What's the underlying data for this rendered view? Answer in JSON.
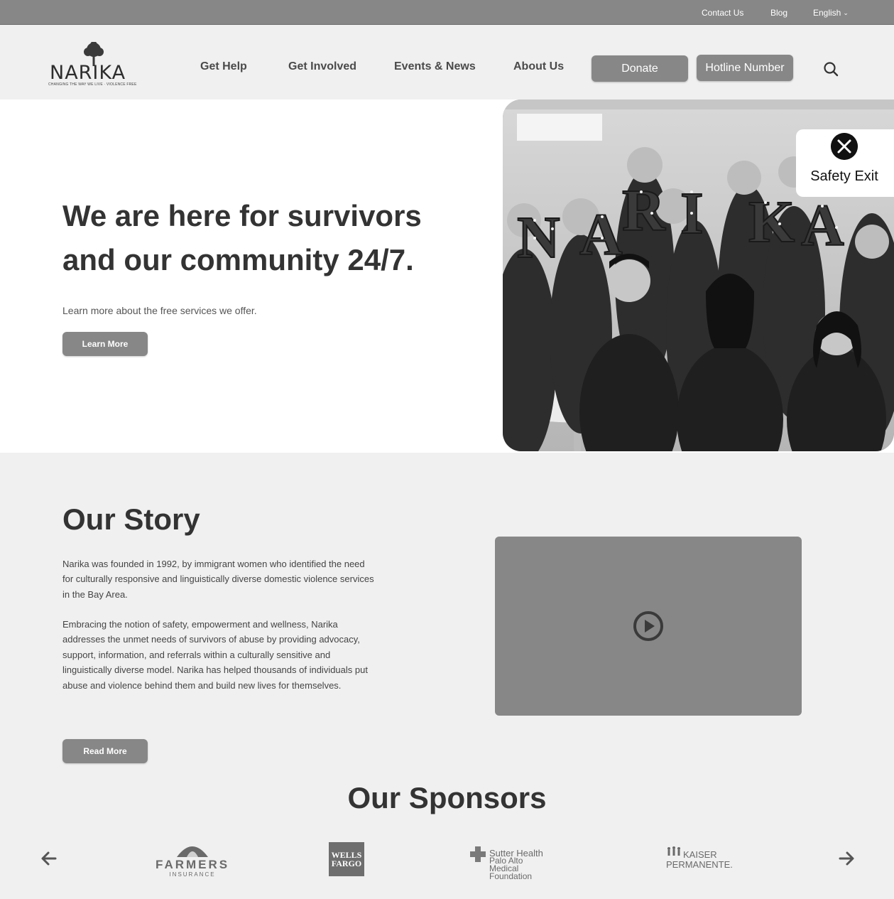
{
  "utility_bar": {
    "contact": "Contact Us",
    "blog": "Blog",
    "language": "English"
  },
  "logo": {
    "name": "NARIKA",
    "tagline": "CHANGING THE WAY WE LIVE · VIOLENCE FREE"
  },
  "nav": {
    "items": [
      "Get Help",
      "Get Involved",
      "Events & News",
      "About Us"
    ],
    "donate": "Donate",
    "hotline": "Hotline Number"
  },
  "hero": {
    "title_line1": "We are here for survivors",
    "title_line2": "and our community 24/7.",
    "subtitle": "Learn more about the free services we offer.",
    "button": "Learn More",
    "photo_letters": "NARIKA"
  },
  "safety_exit": {
    "label": "Safety Exit"
  },
  "story": {
    "title": "Our Story",
    "paragraph1": "Narika was founded in 1992, by immigrant women who identified the need for culturally responsive and linguistically diverse domestic violence services in the Bay Area.",
    "paragraph2": "Embracing the notion of safety, empowerment and wellness, Narika addresses the unmet needs of survivors of abuse by providing advocacy, support, information, and referrals within a culturally sensitive and linguistically diverse model. Narika has helped thousands of individuals put abuse and violence behind them and build new lives for themselves.",
    "button": "Read More"
  },
  "sponsors": {
    "title": "Our Sponsors",
    "farmers": {
      "name": "FARMERS",
      "sub": "INSURANCE"
    },
    "wells_fargo": {
      "line1": "WELLS",
      "line2": "FARGO"
    },
    "sutter": {
      "line1": "Sutter Health",
      "line2": "Palo Alto Medical",
      "line3": "Foundation"
    },
    "kaiser": {
      "line1": "KAISER",
      "line2": "PERMANENTE."
    }
  },
  "colors": {
    "accent_gray": "#878787",
    "text_dark": "#333333",
    "background": "#f0f0f0"
  }
}
